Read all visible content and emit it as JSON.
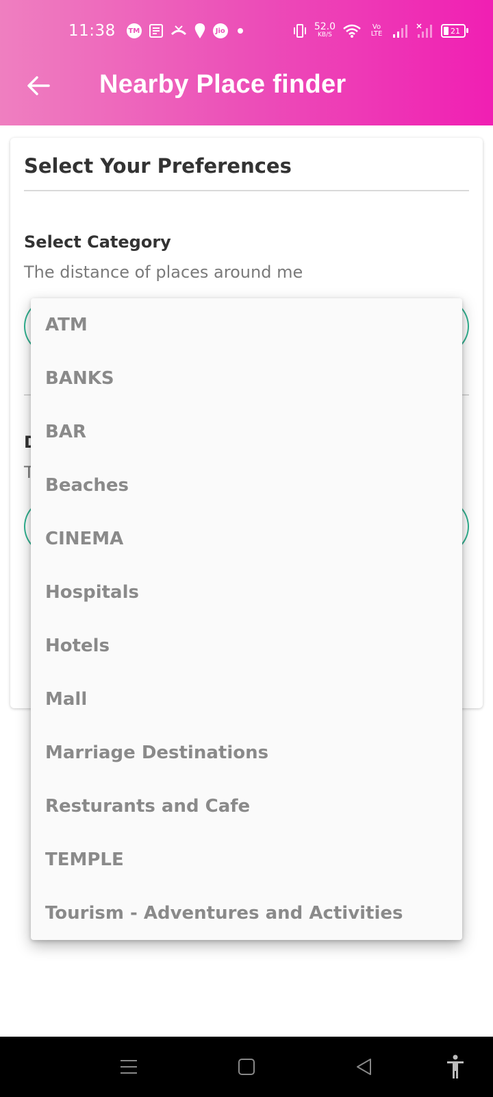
{
  "status_bar": {
    "time": "11:38",
    "network_speed_value": "52.0",
    "network_speed_unit": "KB/S",
    "volte_label": "Vo LTE",
    "battery_level": "21",
    "icons": [
      "tm-icon",
      "news-icon",
      "missed-call-icon",
      "swiggy-icon",
      "jio-icon",
      "dot-icon",
      "vibrate-icon",
      "wifi-icon",
      "signal-icon",
      "signal-x-icon",
      "battery-icon"
    ]
  },
  "header": {
    "title": "Nearby Place finder",
    "back_icon": "arrow-left-icon"
  },
  "card": {
    "title": "Select Your Preferences",
    "category": {
      "label": "Select Category",
      "help": "The distance of places around me"
    },
    "distance": {
      "label_partial": "D",
      "help_partial": "T"
    }
  },
  "dropdown": {
    "options": [
      "ATM",
      "BANKS",
      "BAR",
      "Beaches",
      "CINEMA",
      "Hospitals",
      "Hotels",
      "Mall",
      "Marriage Destinations",
      "Resturants and Cafe",
      "TEMPLE",
      "Tourism - Adventures and Activities"
    ]
  },
  "nav_bar": {
    "buttons": [
      "menu-icon",
      "home-square-icon",
      "back-triangle-icon",
      "accessibility-icon"
    ]
  },
  "colors": {
    "header_gradient_start": "#ef7fc0",
    "header_gradient_end": "#f01fb3",
    "accent_green": "#2fb290",
    "option_text": "#8a8a8a"
  }
}
